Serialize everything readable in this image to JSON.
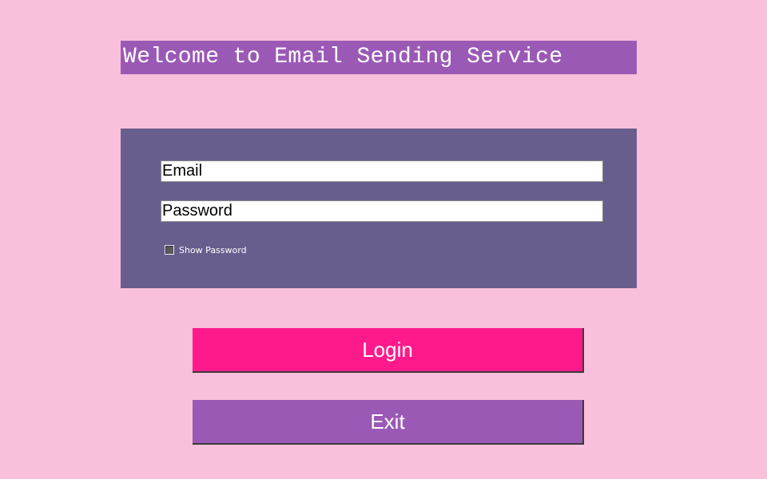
{
  "title": "Welcome to Email Sending Service",
  "form": {
    "email_placeholder": "Email",
    "email_value": "",
    "password_placeholder": "Password",
    "password_value": "",
    "show_password_label": "Show Password",
    "show_password_checked": false
  },
  "buttons": {
    "login_label": "Login",
    "exit_label": "Exit"
  },
  "colors": {
    "background": "#f8c0da",
    "title_bar": "#9b59b6",
    "form_panel": "#685e8e",
    "login_button": "#ff1a8c",
    "exit_button": "#9b59b6"
  }
}
